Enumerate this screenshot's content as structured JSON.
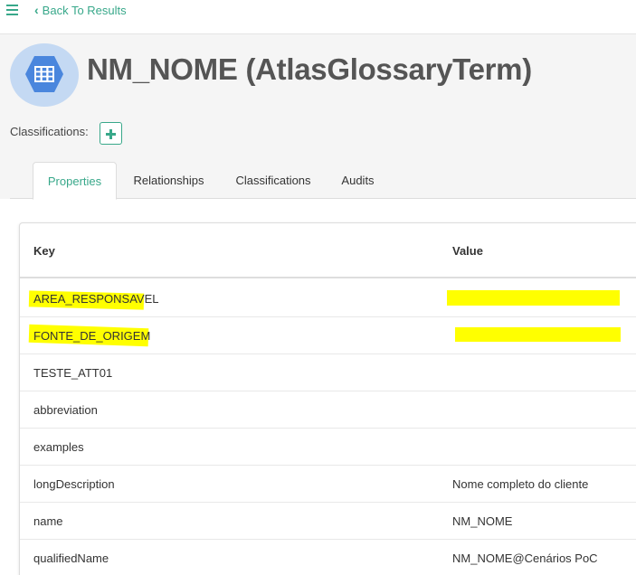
{
  "nav": {
    "back_label": "Back To Results"
  },
  "entity": {
    "title": "NM_NOME (AtlasGlossaryTerm)",
    "classifications_label": "Classifications:"
  },
  "tabs": [
    {
      "label": "Properties",
      "active": true
    },
    {
      "label": "Relationships",
      "active": false
    },
    {
      "label": "Classifications",
      "active": false
    },
    {
      "label": "Audits",
      "active": false
    }
  ],
  "table": {
    "headers": {
      "key": "Key",
      "value": "Value"
    },
    "rows": [
      {
        "key": "AREA_RESPONSAVEL",
        "value": "",
        "highlighted": true
      },
      {
        "key": "FONTE_DE_ORIGEM",
        "value": "",
        "highlighted": true
      },
      {
        "key": "TESTE_ATT01",
        "value": ""
      },
      {
        "key": "abbreviation",
        "value": ""
      },
      {
        "key": "examples",
        "value": ""
      },
      {
        "key": "longDescription",
        "value": "Nome completo do cliente"
      },
      {
        "key": "name",
        "value": "NM_NOME"
      },
      {
        "key": "qualifiedName",
        "value": "NM_NOME@Cenários PoC"
      }
    ]
  },
  "colors": {
    "accent": "#38a88a",
    "highlight": "#ffff00",
    "icon_bg": "#c4d9f3",
    "icon_fg": "#4a86dd"
  },
  "icons": {
    "menu": "hamburger-icon",
    "back": "chevron-left-icon",
    "entity": "table-grid-icon",
    "add": "plus-icon"
  }
}
